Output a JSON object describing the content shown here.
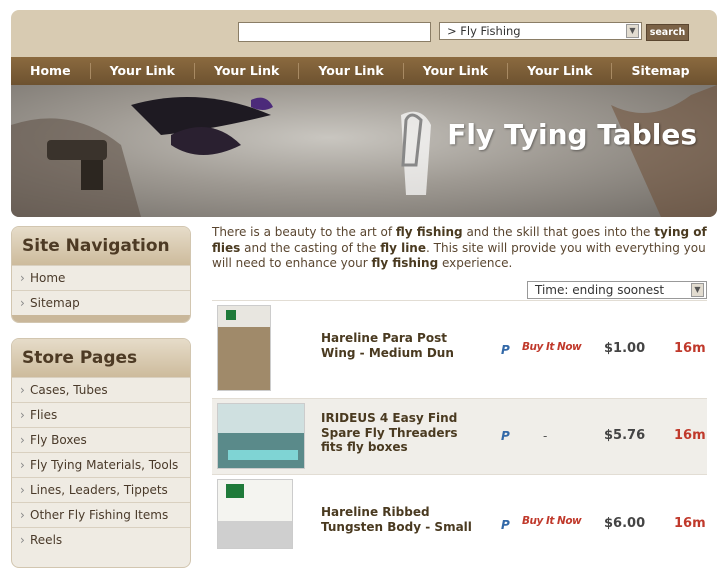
{
  "header": {
    "search_value": "",
    "category_selected": "> Fly Fishing",
    "search_label": "search"
  },
  "nav": [
    "Home",
    "Your Link",
    "Your Link",
    "Your Link",
    "Your Link",
    "Your Link",
    "Sitemap"
  ],
  "banner": {
    "title": "Fly Tying Tables"
  },
  "site_navigation": {
    "heading": "Site Navigation",
    "items": [
      "Home",
      "Sitemap"
    ]
  },
  "store_pages": {
    "heading": "Store Pages",
    "items": [
      "Cases, Tubes",
      "Flies",
      "Fly Boxes",
      "Fly Tying Materials, Tools",
      "Lines, Leaders, Tippets",
      "Other Fly Fishing Items",
      "Reels"
    ]
  },
  "intro": {
    "p1": "There is a beauty to the art of ",
    "b1": "fly fishing",
    "p2": " and the skill that goes into the ",
    "b2": "tying of flies",
    "p3": " and the casting of the ",
    "b3": "fly line",
    "p4": ".  This site will provide you with everything you will need to enhance your ",
    "b4": "fly fishing",
    "p5": " experience."
  },
  "sort": {
    "selected": "Time: ending soonest"
  },
  "listings": [
    {
      "title": "Hareline Para Post Wing - Medium Dun",
      "buy": "Buy It Now",
      "price": "$1.00",
      "time": "16m"
    },
    {
      "title": "IRIDEUS 4 Easy Find Spare Fly Threaders fits fly boxes",
      "buy": "-",
      "price": "$5.76",
      "time": "16m"
    },
    {
      "title": "Hareline Ribbed Tungsten Body - Small",
      "buy": "Buy It Now",
      "price": "$6.00",
      "time": "16m"
    }
  ],
  "colors": {
    "accent": "#6d5230",
    "time": "#c0392b"
  }
}
